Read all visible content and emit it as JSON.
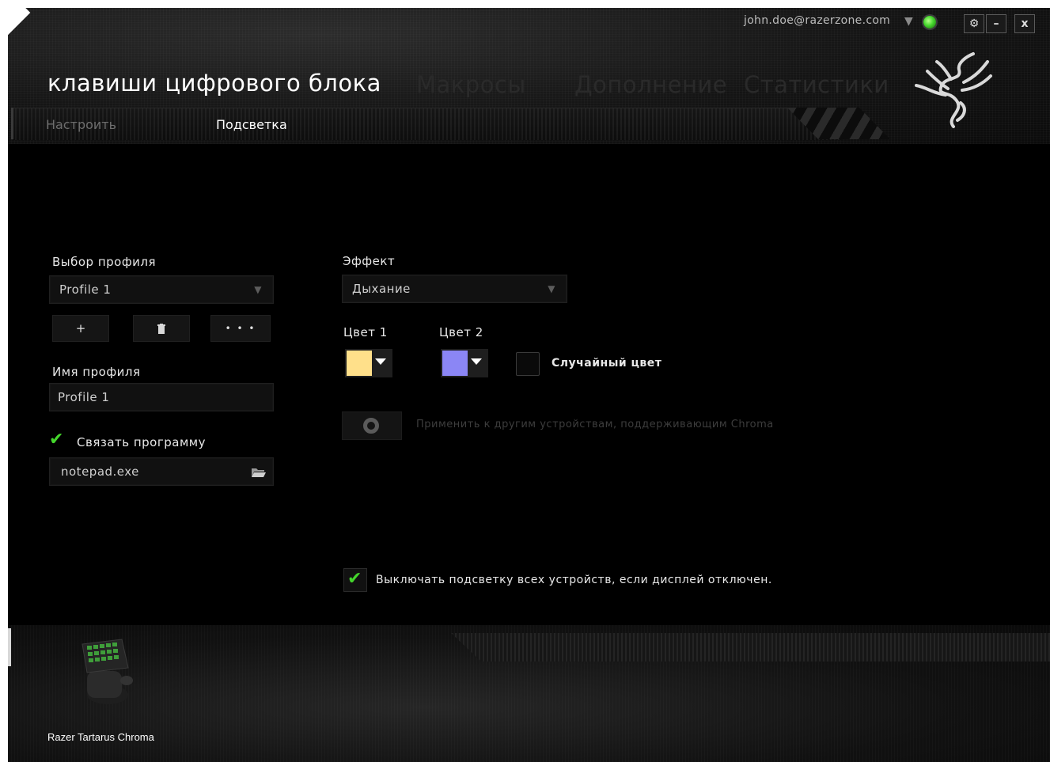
{
  "header": {
    "account_email": "john.doe@razerzone.com",
    "title": "клавиши цифрового блока",
    "nav_tabs": [
      "Макросы",
      "Дополнение",
      "Статистики"
    ],
    "window_controls": {
      "settings": "⚙",
      "minimize": "–",
      "close": "x"
    }
  },
  "subnav": {
    "items": [
      {
        "label": "Настроить",
        "active": false
      },
      {
        "label": "Подсветка",
        "active": true
      }
    ]
  },
  "profile": {
    "select_label": "Выбор профиля",
    "selected_profile": "Profile 1",
    "buttons": {
      "add": "+",
      "delete": "🗑",
      "more": "• • •"
    },
    "name_label": "Имя профиля",
    "name_value": "Profile 1",
    "link_program_label": "Связать программу",
    "link_program_checked": true,
    "program_value": "notepad.exe"
  },
  "effect": {
    "label": "Эффект",
    "selected": "Дыхание",
    "color1_label": "Цвет 1",
    "color1": "#ffe08a",
    "color2_label": "Цвет 2",
    "color2": "#8b86f5",
    "random_color_label": "Случайный цвет",
    "random_color_checked": false,
    "apply_chroma_label": "Применить к другим устройствам, поддерживающим Chroma",
    "turn_off_label": "Выключать подсветку всех устройств, если дисплей отключен.",
    "turn_off_checked": true
  },
  "footer": {
    "device_name": "Razer Tartarus Chroma"
  },
  "colors": {
    "accent": "#44d62c",
    "background": "#000000"
  }
}
